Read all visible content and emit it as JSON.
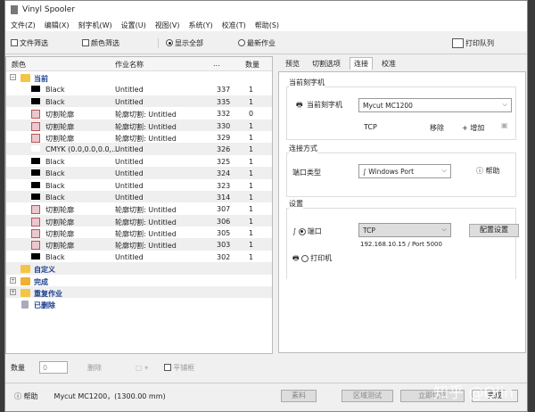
{
  "window": {
    "title": "Vinyl Spooler"
  },
  "menu": [
    "文件(Z)",
    "编辑(X)",
    "刻字机(W)",
    "设置(U)",
    "视图(V)",
    "系统(Y)",
    "校准(T)",
    "帮助(S)"
  ],
  "toolbar": {
    "file_filter": "文件筛选",
    "color_filter": "颜色筛选",
    "show_all": "显示全部",
    "latest_jobs": "最新作业",
    "print_queue": "打印队列"
  },
  "list": {
    "headers": [
      "颜色",
      "作业名称",
      "...",
      "数量"
    ],
    "groups": {
      "current": "当前",
      "custom": "自定义",
      "done": "完成",
      "repeat": "重复作业",
      "deleted": "已删除"
    },
    "rows": [
      {
        "kind": "black",
        "color": "Black",
        "job": "Untitled",
        "num": "337",
        "qty": "1"
      },
      {
        "kind": "black",
        "color": "Black",
        "job": "Untitled",
        "num": "335",
        "qty": "1"
      },
      {
        "kind": "cut",
        "color": "切割轮廓",
        "job": "轮廓切割: Untitled",
        "num": "332",
        "qty": "0"
      },
      {
        "kind": "cut",
        "color": "切割轮廓",
        "job": "轮廓切割: Untitled",
        "num": "330",
        "qty": "1"
      },
      {
        "kind": "cut",
        "color": "切割轮廓",
        "job": "轮廓切割: Untitled",
        "num": "329",
        "qty": "1"
      },
      {
        "kind": "white",
        "color": "CMYK (0.0,0.0,0.0,...",
        "job": "Untitled",
        "num": "326",
        "qty": "1"
      },
      {
        "kind": "black",
        "color": "Black",
        "job": "Untitled",
        "num": "325",
        "qty": "1"
      },
      {
        "kind": "black",
        "color": "Black",
        "job": "Untitled",
        "num": "324",
        "qty": "1"
      },
      {
        "kind": "black",
        "color": "Black",
        "job": "Untitled",
        "num": "323",
        "qty": "1"
      },
      {
        "kind": "black",
        "color": "Black",
        "job": "Untitled",
        "num": "314",
        "qty": "1"
      },
      {
        "kind": "cut",
        "color": "切割轮廓",
        "job": "轮廓切割: Untitled",
        "num": "307",
        "qty": "1"
      },
      {
        "kind": "cut",
        "color": "切割轮廓",
        "job": "轮廓切割: Untitled",
        "num": "306",
        "qty": "1"
      },
      {
        "kind": "cut",
        "color": "切割轮廓",
        "job": "轮廓切割: Untitled",
        "num": "305",
        "qty": "1"
      },
      {
        "kind": "cut",
        "color": "切割轮廓",
        "job": "轮廓切割: Untitled",
        "num": "303",
        "qty": "1"
      },
      {
        "kind": "black",
        "color": "Black",
        "job": "Untitled",
        "num": "302",
        "qty": "1"
      }
    ]
  },
  "bottom_tools": {
    "qty_label": "数量",
    "qty_value": "0",
    "delete": "删除",
    "tile": "平铺框"
  },
  "status": {
    "help": "帮助",
    "device": "Mycut MC1200，(1300.00 mm)"
  },
  "tabs": [
    "预览",
    "切割选项",
    "连接",
    "校准"
  ],
  "connection": {
    "current_cutter_group": "当前刻字机",
    "current_cutter_label": "当前刻字机",
    "cutter": "Mycut MC1200",
    "protocol": "TCP",
    "remove": "移除",
    "add": "增加",
    "conn_group": "连接方式",
    "port_type_label": "端口类型",
    "port_type": "Windows Port",
    "help": "帮助",
    "settings_group": "设置",
    "port_label": "端口",
    "port_value": "TCP",
    "address": "192.168.10.15 /  Port 5000",
    "config": "配置设置",
    "printer_label": "打印机"
  },
  "actions": [
    "素料",
    "区域测试",
    "立即切割",
    "完成"
  ],
  "watermark": "知乎 @Qlin"
}
